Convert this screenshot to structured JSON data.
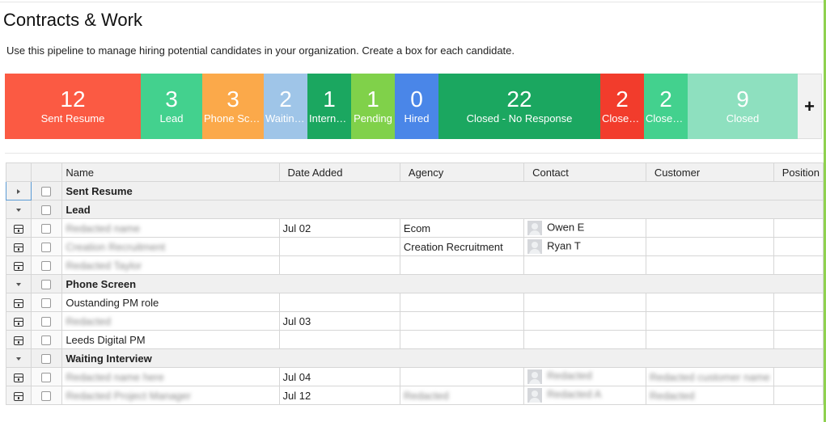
{
  "page": {
    "title": "Contracts & Work",
    "description": "Use this pipeline to manage hiring potential candidates in your organization. Create a box for each candidate."
  },
  "stages": [
    {
      "count": "12",
      "label": "Sent Resume",
      "color": "#fb5a43"
    },
    {
      "count": "3",
      "label": "Lead",
      "color": "#43d18e"
    },
    {
      "count": "3",
      "label": "Phone Screen",
      "color": "#fba94a"
    },
    {
      "count": "2",
      "label": "Waiting Interview",
      "color": "#9fc5e8"
    },
    {
      "count": "1",
      "label": "Internal Interview",
      "color": "#1ba760"
    },
    {
      "count": "1",
      "label": "Pending",
      "color": "#80d14a"
    },
    {
      "count": "0",
      "label": "Hired",
      "color": "#4a86e8"
    },
    {
      "count": "22",
      "label": "Closed - No Response",
      "color": "#1ba760"
    },
    {
      "count": "2",
      "label": "Closed - Lost",
      "color": "#f23c2c"
    },
    {
      "count": "2",
      "label": "Closed - Other",
      "color": "#43d18e"
    },
    {
      "count": "9",
      "label": "Closed",
      "color": "#8ee0bf"
    }
  ],
  "add_stage_label": "+",
  "table": {
    "columns": [
      "Name",
      "Date Added",
      "Agency",
      "Contact",
      "Customer",
      "Position"
    ],
    "rows": [
      {
        "type": "group",
        "label": "Sent Resume",
        "collapsed": true
      },
      {
        "type": "group",
        "label": "Lead",
        "collapsed": false
      },
      {
        "type": "item",
        "name": "Redacted name",
        "name_blurred": true,
        "date": "Jul 02",
        "agency": "Ecom",
        "contact": "Owen E",
        "contact_avatar": true,
        "customer": "",
        "position": ""
      },
      {
        "type": "item",
        "name": "Creation Recruitment",
        "name_blurred": true,
        "date": "",
        "agency": "Creation Recruitment",
        "contact": "Ryan T",
        "contact_avatar": true,
        "customer": "",
        "position": ""
      },
      {
        "type": "item",
        "name": "Redacted Taylor",
        "name_blurred": true,
        "date": "",
        "agency": "",
        "contact": "",
        "contact_avatar": false,
        "customer": "",
        "position": ""
      },
      {
        "type": "group",
        "label": "Phone Screen",
        "collapsed": false
      },
      {
        "type": "item",
        "name": "Oustanding PM role",
        "name_blurred": false,
        "date": "",
        "agency": "",
        "contact": "",
        "contact_avatar": false,
        "customer": "",
        "position": ""
      },
      {
        "type": "item",
        "name": "Redacted",
        "name_blurred": true,
        "date": "Jul 03",
        "agency": "",
        "contact": "",
        "contact_avatar": false,
        "customer": "",
        "position": ""
      },
      {
        "type": "item",
        "name": "Leeds Digital PM",
        "name_blurred": false,
        "date": "",
        "agency": "",
        "contact": "",
        "contact_avatar": false,
        "customer": "",
        "position": ""
      },
      {
        "type": "group",
        "label": "Waiting Interview",
        "collapsed": false
      },
      {
        "type": "item",
        "name": "Redacted name here",
        "name_blurred": true,
        "date": "Jul 04",
        "agency": "",
        "contact": "Redacted",
        "contact_blurred": true,
        "contact_avatar": true,
        "customer": "Redacted customer name",
        "customer_blurred": true,
        "position": ""
      },
      {
        "type": "item",
        "name": "Redacted Project Manager",
        "name_blurred": true,
        "date": "Jul 12",
        "agency": "Redacted",
        "agency_blurred": true,
        "contact": "Redacted A",
        "contact_blurred": true,
        "contact_avatar": true,
        "customer": "Redacted",
        "customer_blurred": true,
        "position": ""
      }
    ]
  }
}
